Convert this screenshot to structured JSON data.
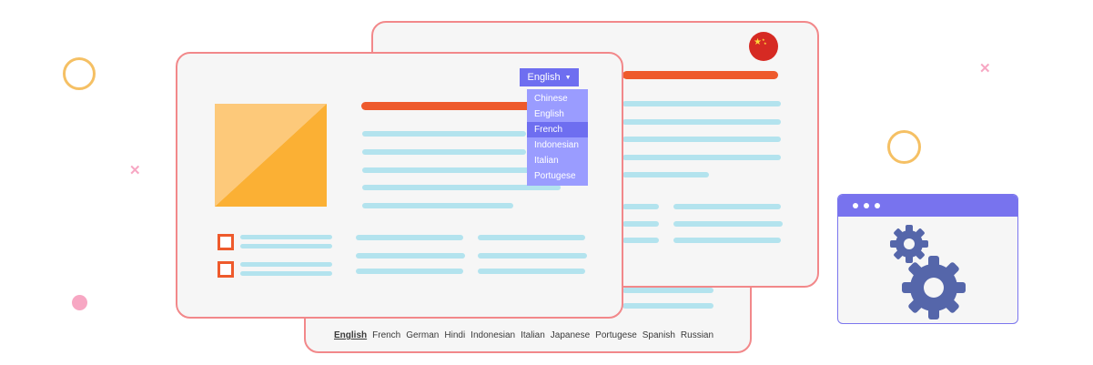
{
  "language_menu": {
    "selected": "English",
    "options": [
      "Chinese",
      "English",
      "French",
      "Indonesian",
      "Italian",
      "Portugese"
    ],
    "highlighted": "French"
  },
  "language_bar": [
    "English",
    "French",
    "German",
    "Hindi",
    "Indonesian",
    "Italian",
    "Japanese",
    "Portugese",
    "Spanish",
    "Russian"
  ],
  "language_bar_active": "English",
  "flag": "china-flag",
  "icons": [
    "chevron-down-icon",
    "gear-icon"
  ],
  "colors": {
    "card_border": "#f2888a",
    "accent_orange": "#ee5a2c",
    "text_line": "#b3e3ee",
    "dropdown_bg": "#6e6ef0",
    "dropdown_list_bg": "#9a9cff",
    "gear": "#5566aa",
    "ring": "#f5c064",
    "image_light": "#fdc97a",
    "image_dark": "#fbb034"
  }
}
